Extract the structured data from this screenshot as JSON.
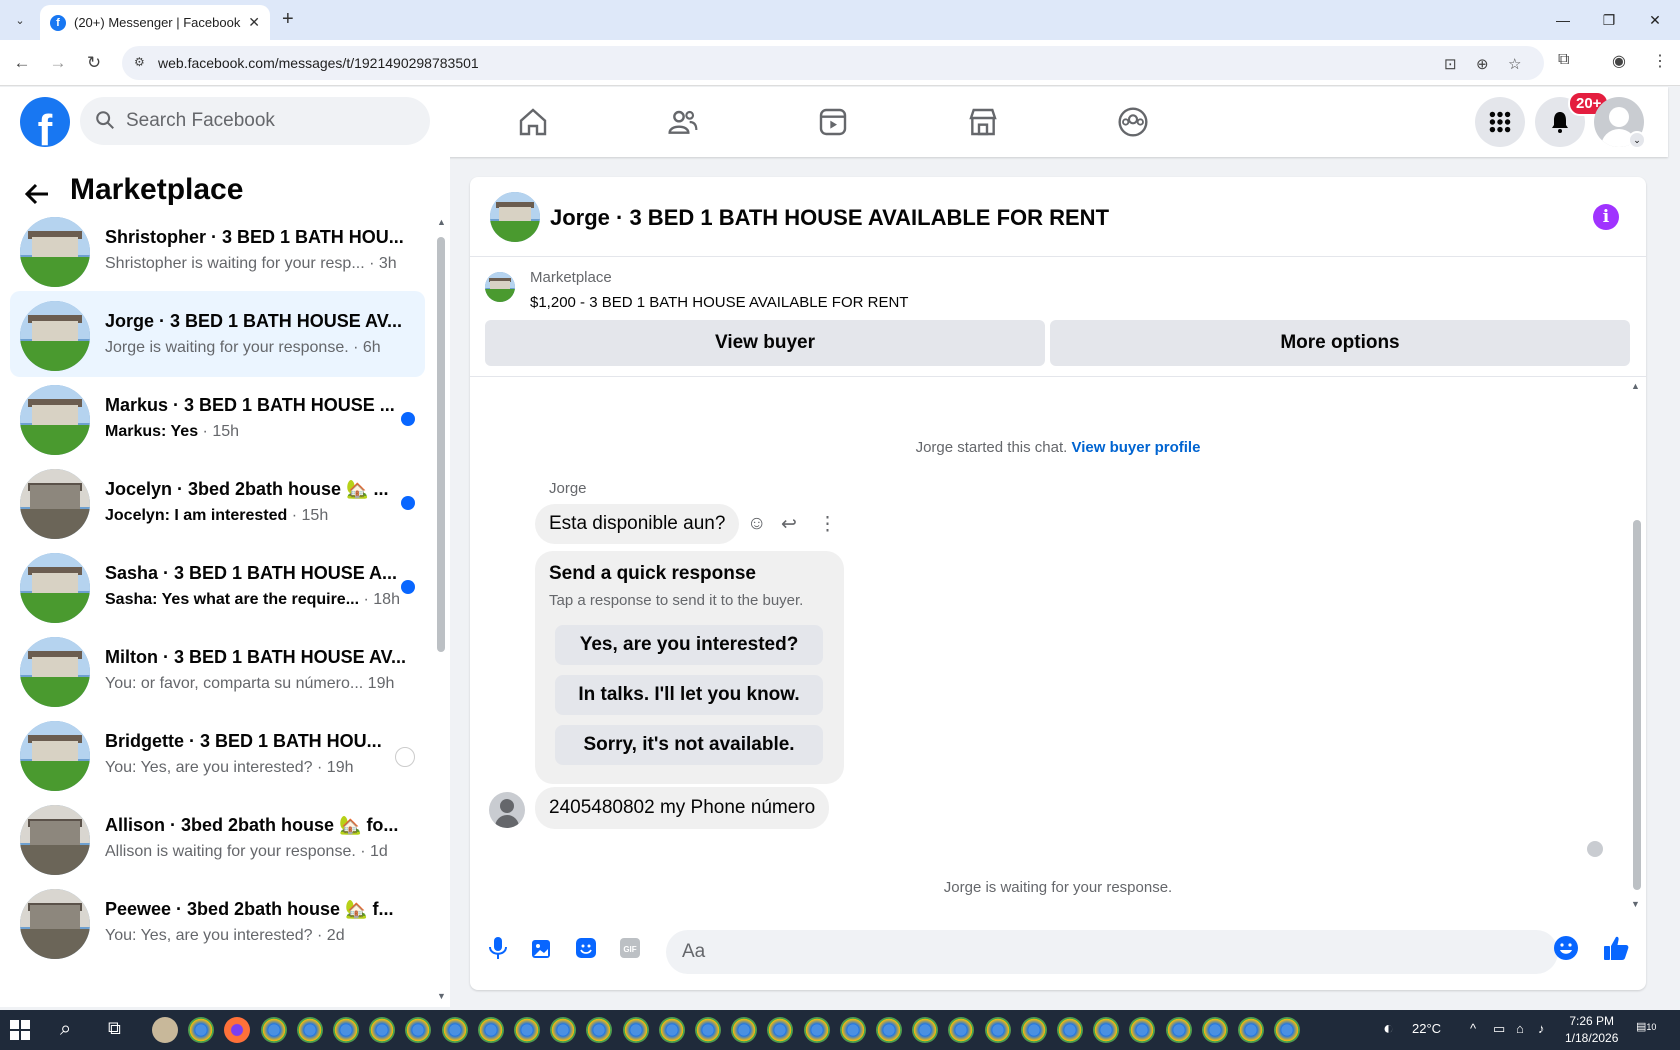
{
  "browser": {
    "tab_title": "(20+) Messenger | Facebook",
    "url": "web.facebook.com/messages/t/1921490298783501"
  },
  "header": {
    "search_placeholder": "Search Facebook",
    "notification_badge": "20+"
  },
  "sidebar": {
    "title": "Marketplace",
    "conversations": [
      {
        "name": "Shristopher · 3 BED 1 BATH HOU...",
        "preview": "Shristopher is waiting for your resp...",
        "time": "· 3h",
        "unread": false,
        "thumb": "house-a"
      },
      {
        "name": "Jorge · 3 BED 1 BATH HOUSE AV...",
        "preview": "Jorge is waiting for your response.",
        "time": "· 6h",
        "unread": false,
        "thumb": "house-a",
        "active": true
      },
      {
        "name": "Markus · 3 BED 1 BATH HOUSE ...",
        "preview": "Markus: Yes",
        "time": "· 15h",
        "unread": true,
        "thumb": "house-a"
      },
      {
        "name": "Jocelyn · 3bed 2bath house 🏡 ...",
        "preview": "Jocelyn: I am interested",
        "time": "· 15h",
        "unread": true,
        "thumb": "house-b"
      },
      {
        "name": "Sasha · 3 BED 1 BATH HOUSE A...",
        "preview": "Sasha: Yes what are the require...",
        "time": "· 18h",
        "unread": true,
        "thumb": "house-a"
      },
      {
        "name": "Milton · 3 BED 1 BATH HOUSE AV...",
        "preview": "You: or favor, comparta su número...",
        "time": "19h",
        "unread": false,
        "thumb": "house-a"
      },
      {
        "name": "Bridgette · 3 BED 1 BATH HOU...",
        "preview": "You: Yes, are you interested?",
        "time": "· 19h",
        "unread": false,
        "thumb": "house-a"
      },
      {
        "name": "Allison · 3bed 2bath house 🏡 fo...",
        "preview": "Allison is waiting for your response.",
        "time": "· 1d",
        "unread": false,
        "thumb": "house-b"
      },
      {
        "name": "Peewee · 3bed 2bath house 🏡 f...",
        "preview": "You: Yes, are you interested?",
        "time": "· 2d",
        "unread": false,
        "thumb": "house-b"
      }
    ]
  },
  "chat": {
    "title": "Jorge · 3 BED 1 BATH HOUSE AVAILABLE FOR RENT",
    "listing_label": "Marketplace",
    "listing_desc": "$1,200 - 3 BED 1 BATH HOUSE AVAILABLE FOR RENT",
    "view_buyer": "View buyer",
    "more_options": "More options",
    "started_text": "Jorge started this chat.",
    "view_profile": "View buyer profile",
    "sender": "Jorge",
    "message1": "Esta disponible aun?",
    "quick_title": "Send a quick response",
    "quick_sub": "Tap a response to send it to the buyer.",
    "quick_options": [
      "Yes, are you interested?",
      "In talks. I'll let you know.",
      "Sorry, it's not available."
    ],
    "message2": "2405480802 my Phone número",
    "waiting": "Jorge is waiting for your response.",
    "input_placeholder": "Aa"
  },
  "taskbar": {
    "temperature": "22°C",
    "time": "7:26 PM",
    "date": "1/18/2026",
    "notif_count": "10"
  },
  "colors": {
    "fb_blue": "#1877f2",
    "unread_dot": "#0866ff",
    "info_purple": "#a033ff",
    "badge_red": "#e41e3f"
  }
}
